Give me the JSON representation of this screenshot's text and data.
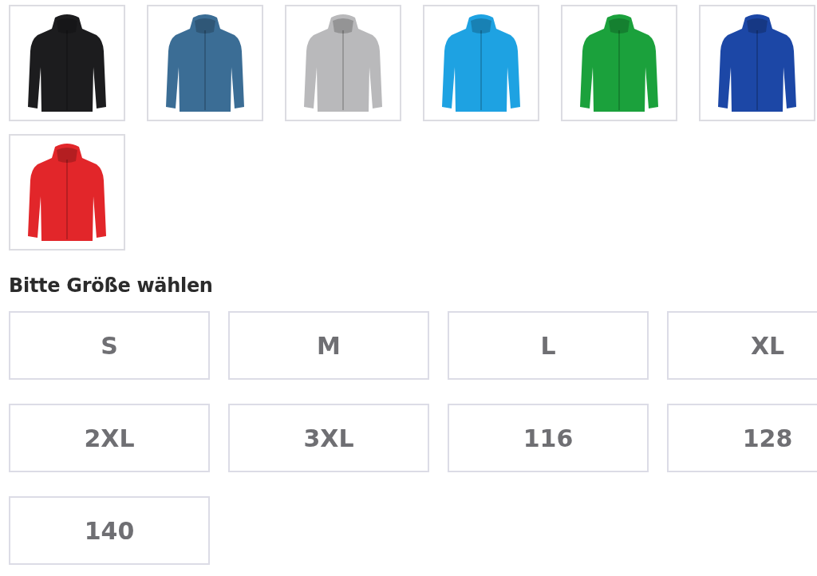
{
  "color_swatches": [
    {
      "color": "#1c1c1e"
    },
    {
      "color": "#3b6d95"
    },
    {
      "color": "#b9b9bb"
    },
    {
      "color": "#1ea2e2"
    },
    {
      "color": "#1ba13c"
    },
    {
      "color": "#1c47a6"
    },
    {
      "color": "#e2262a"
    }
  ],
  "size_heading": "Bitte Größe wählen",
  "sizes": [
    {
      "label": "S"
    },
    {
      "label": "M"
    },
    {
      "label": "L"
    },
    {
      "label": "XL"
    },
    {
      "label": "2XL"
    },
    {
      "label": "3XL"
    },
    {
      "label": "116"
    },
    {
      "label": "128"
    },
    {
      "label": "140"
    }
  ]
}
